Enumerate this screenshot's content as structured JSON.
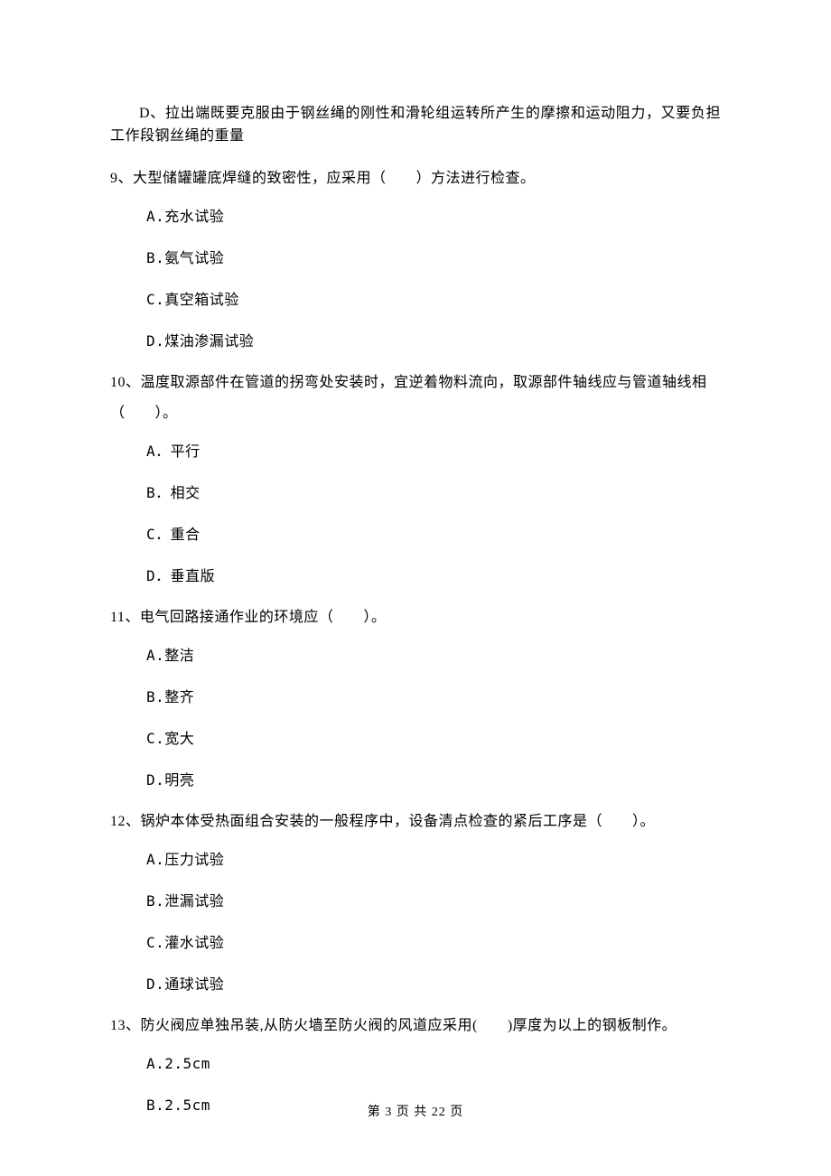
{
  "previous_option_d": "D、拉出端既要克服由于钢丝绳的刚性和滑轮组运转所产生的摩擦和运动阻力，又要负担工作段钢丝绳的重量",
  "questions": [
    {
      "number": "9",
      "stem": "9、大型储罐罐底焊缝的致密性，应采用（　　）方法进行检查。",
      "options": {
        "a": "A.充水试验",
        "b": "B.氨气试验",
        "c": "C.真空箱试验",
        "d": "D.煤油渗漏试验"
      }
    },
    {
      "number": "10",
      "stem_line1": "10、温度取源部件在管道的拐弯处安装时，宜逆着物料流向，取源部件轴线应与管道轴线相",
      "stem_line2": "（　　）。",
      "options": {
        "a": "A．平行",
        "b": "B．相交",
        "c": "C．重合",
        "d": "D．垂直版"
      }
    },
    {
      "number": "11",
      "stem": "11、电气回路接通作业的环境应（　　）。",
      "options": {
        "a": "A.整洁",
        "b": "B.整齐",
        "c": "C.宽大",
        "d": "D.明亮"
      }
    },
    {
      "number": "12",
      "stem": "12、锅炉本体受热面组合安装的一般程序中，设备清点检查的紧后工序是（　　）。",
      "options": {
        "a": "A.压力试验",
        "b": "B.泄漏试验",
        "c": "C.灌水试验",
        "d": "D.通球试验"
      }
    },
    {
      "number": "13",
      "stem": "13、防火阀应单独吊装,从防火墙至防火阀的风道应采用(　　)厚度为以上的钢板制作。",
      "options": {
        "a": "A.2.5cm",
        "b": "B.2.5cm"
      }
    }
  ],
  "footer": "第 3 页 共 22 页"
}
